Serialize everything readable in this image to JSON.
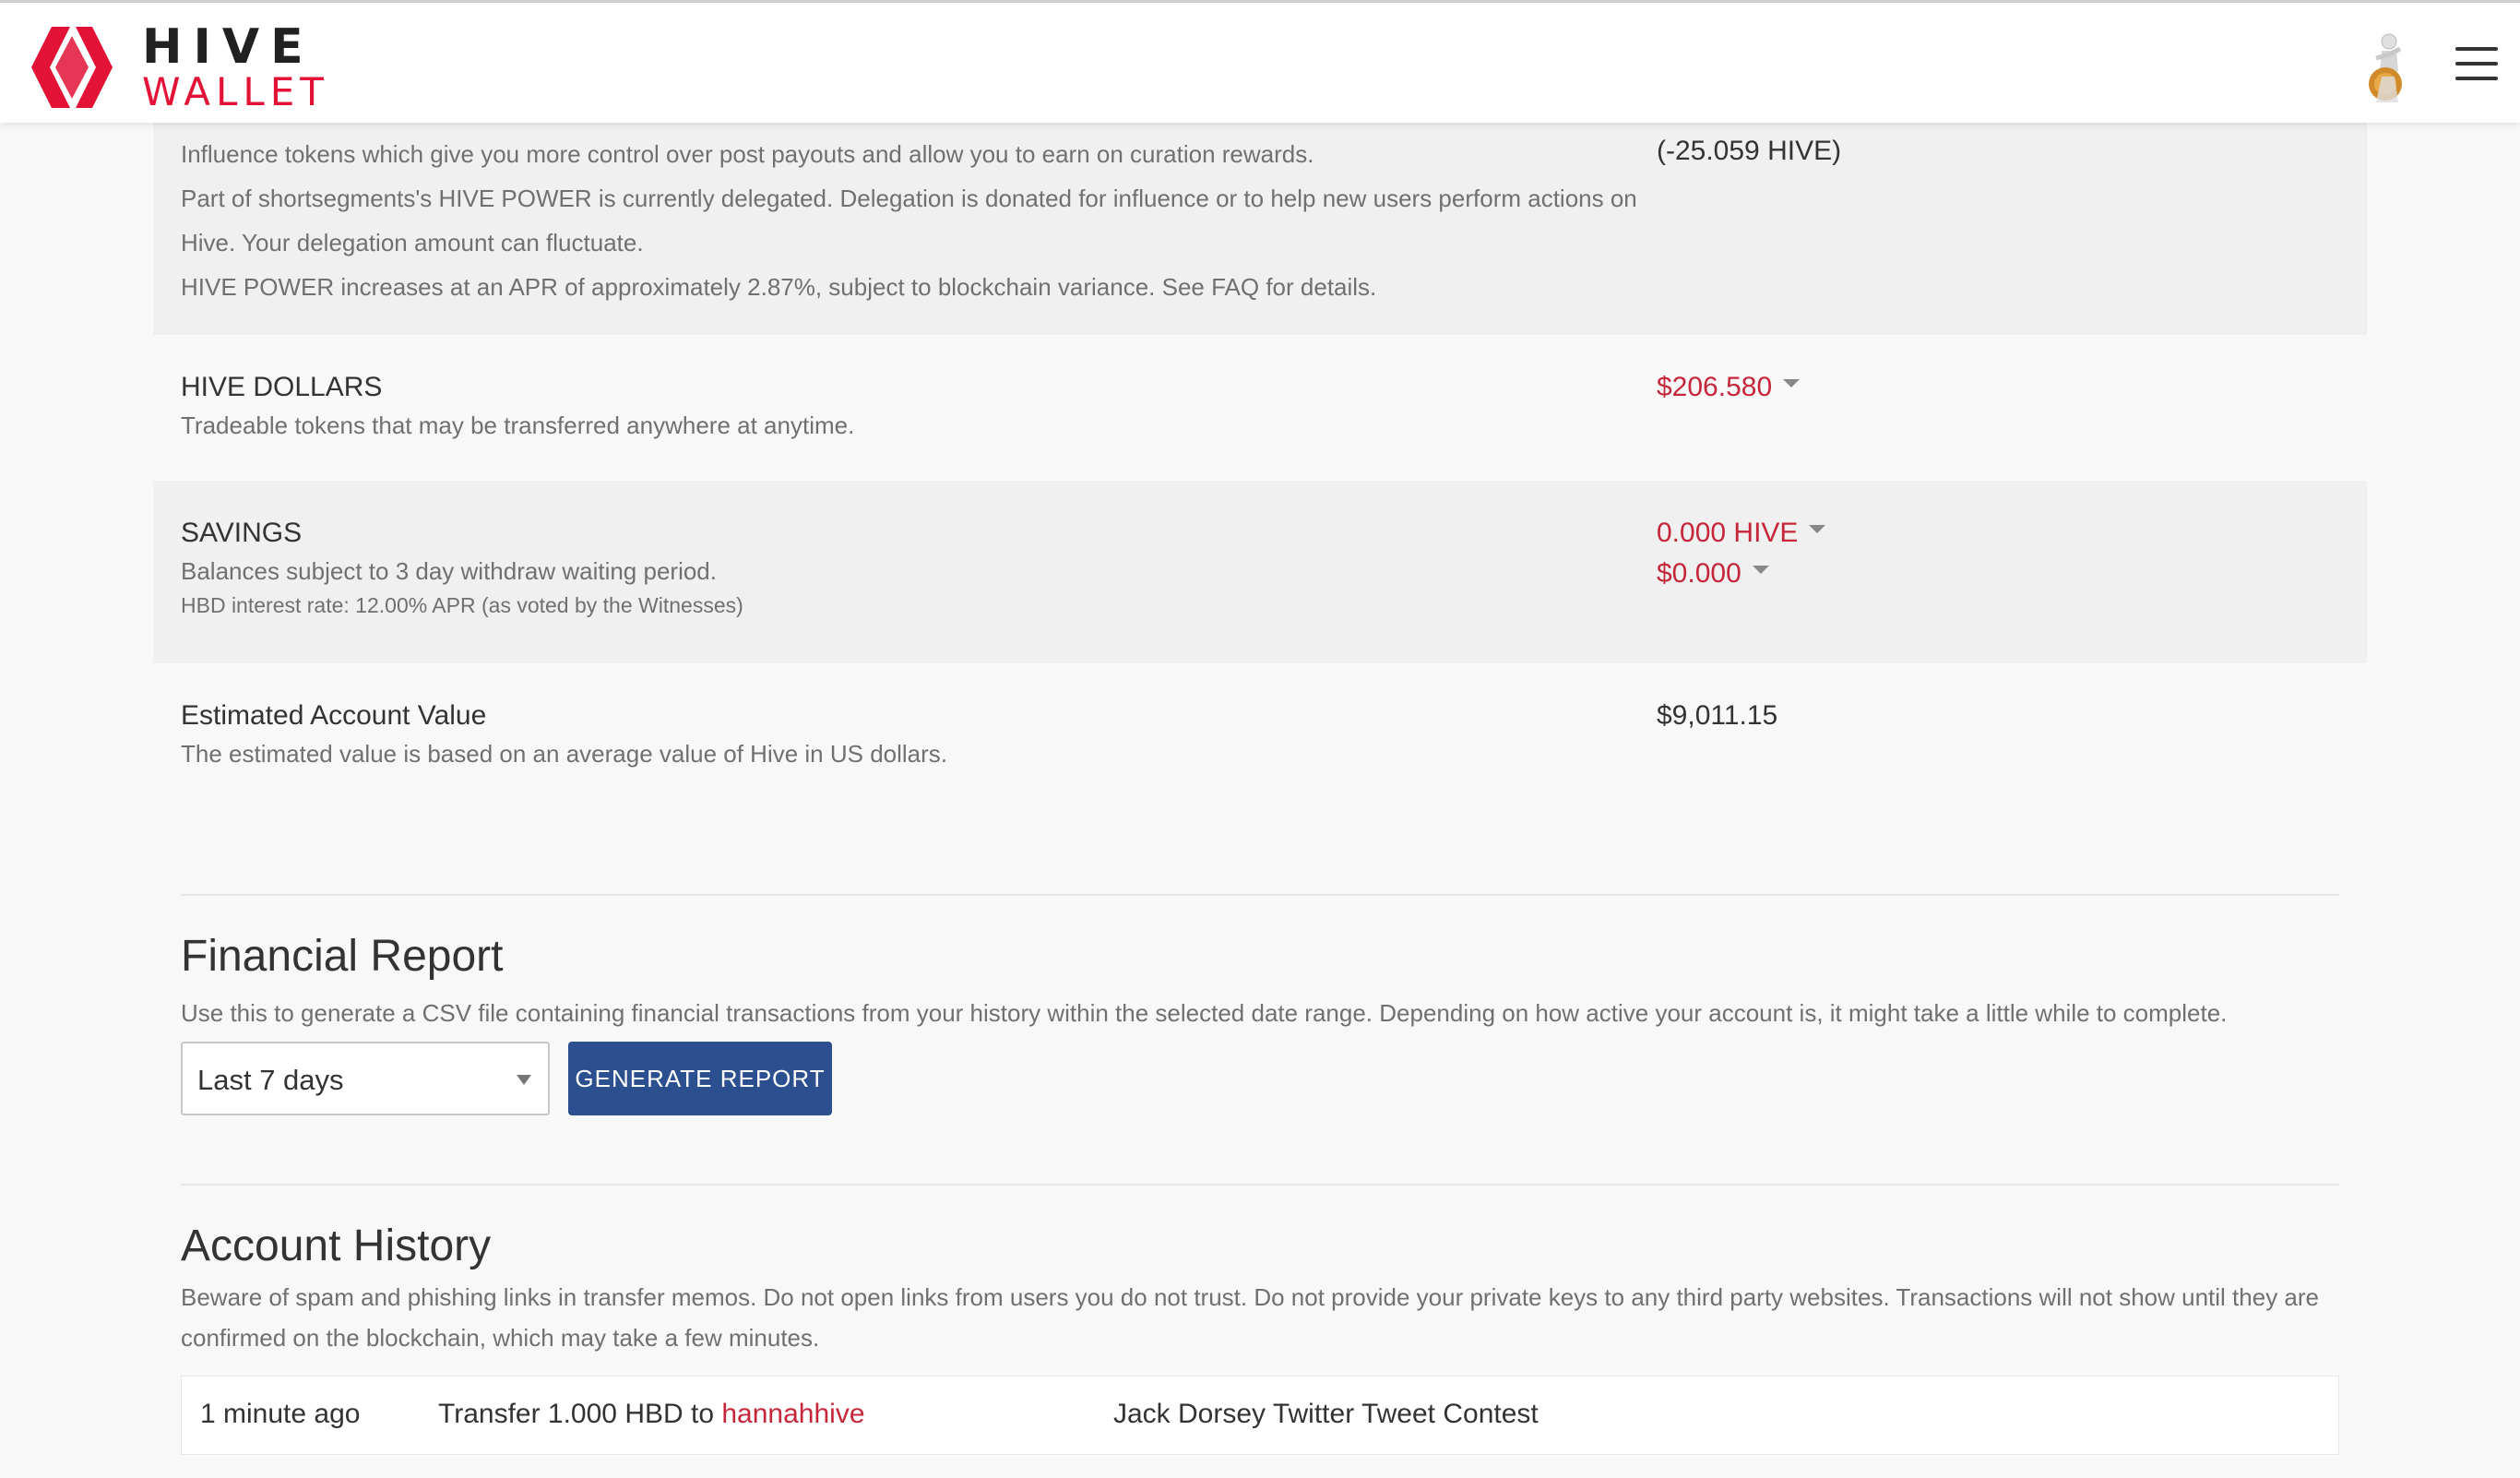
{
  "header": {
    "logo_top": "HIVE",
    "logo_bottom": "WALLET",
    "accent": "#e31337"
  },
  "hive_power": {
    "desc1": "Influence tokens which give you more control over post payouts and allow you to earn on curation rewards.",
    "desc2": "Part of shortsegments's HIVE POWER is currently delegated. Delegation is donated for influence or to help new users perform actions on Hive. Your delegation amount can fluctuate.",
    "desc3": "HIVE POWER increases at an APR of approximately 2.87%, subject to blockchain variance. See FAQ for details.",
    "delegated": "(-25.059 HIVE)"
  },
  "hive_dollars": {
    "title": "HIVE DOLLARS",
    "desc": "Tradeable tokens that may be transferred anywhere at anytime.",
    "value": "$206.580"
  },
  "savings": {
    "title": "SAVINGS",
    "desc": "Balances subject to 3 day withdraw waiting period.",
    "interest": "HBD interest rate: 12.00% APR (as voted by the Witnesses)",
    "hive_value": "0.000 HIVE",
    "hbd_value": "$0.000"
  },
  "estimated": {
    "title": "Estimated Account Value",
    "desc": "The estimated value is based on an average value of Hive in US dollars.",
    "value": "$9,011.15"
  },
  "financial_report": {
    "title": "Financial Report",
    "desc": "Use this to generate a CSV file containing financial transactions from your history within the selected date range. Depending on how active your account is, it might take a little while to complete.",
    "range_selected": "Last 7 days",
    "button": "GENERATE REPORT"
  },
  "account_history": {
    "title": "Account History",
    "desc": "Beware of spam and phishing links in transfer memos. Do not open links from users you do not trust. Do not provide your private keys to any third party websites. Transactions will not show until they are confirmed on the blockchain, which may take a few minutes.",
    "rows": [
      {
        "time": "1 minute ago",
        "op_prefix": "Transfer 1.000 HBD to ",
        "recipient": "hannahhive",
        "memo": "Jack Dorsey Twitter Tweet Contest"
      }
    ]
  }
}
